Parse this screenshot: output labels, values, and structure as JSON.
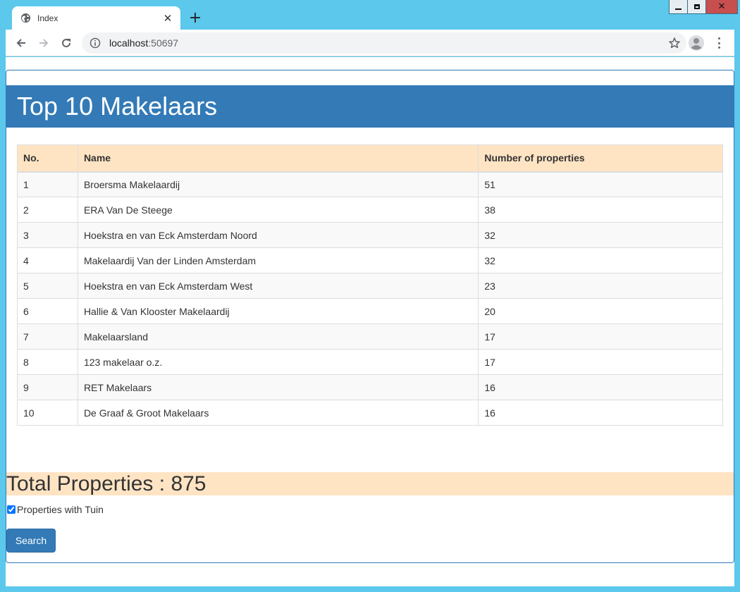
{
  "browser": {
    "tab_title": "Index",
    "new_tab_label": "+",
    "url_host": "localhost",
    "url_port": ":50697"
  },
  "window_controls": {
    "close_glyph": "✕"
  },
  "page": {
    "heading": "Top 10 Makelaars",
    "table": {
      "headers": [
        "No.",
        "Name",
        "Number of properties"
      ],
      "rows": [
        [
          "1",
          "Broersma Makelaardij",
          "51"
        ],
        [
          "2",
          "ERA Van De Steege",
          "38"
        ],
        [
          "3",
          "Hoekstra en van Eck Amsterdam Noord",
          "32"
        ],
        [
          "4",
          "Makelaardij Van der Linden Amsterdam",
          "32"
        ],
        [
          "5",
          "Hoekstra en van Eck Amsterdam West",
          "23"
        ],
        [
          "6",
          "Hallie & Van Klooster Makelaardij",
          "20"
        ],
        [
          "7",
          "Makelaarsland",
          "17"
        ],
        [
          "8",
          "123 makelaar o.z.",
          "17"
        ],
        [
          "9",
          "RET Makelaars",
          "16"
        ],
        [
          "10",
          "De Graaf & Groot Makelaars",
          "16"
        ]
      ]
    },
    "total_label": "Total Properties : 875",
    "tuin_checkbox_label": "Properties with Tuin",
    "tuin_checked": true,
    "search_button": "Search"
  },
  "colors": {
    "window_frame": "#5bc8ec",
    "primary": "#337ab7",
    "header_row": "#ffe4c4",
    "close_button": "#c74f4f"
  },
  "icons": {
    "tab_favicon": "globe-icon",
    "back": "arrow-left-icon",
    "forward": "arrow-right-icon",
    "reload": "reload-icon",
    "info": "info-icon",
    "bookmark": "star-icon",
    "profile": "avatar-icon",
    "menu": "kebab-menu-icon"
  }
}
